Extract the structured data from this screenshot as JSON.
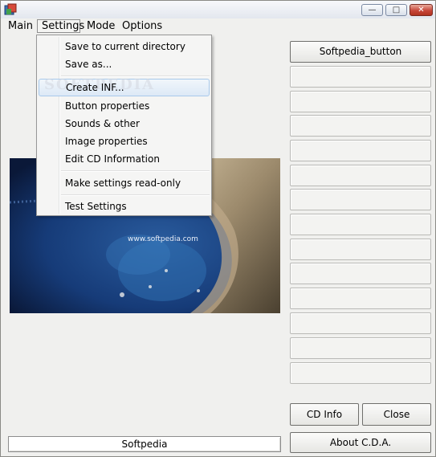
{
  "menubar": {
    "items": [
      "Main",
      "Settings",
      "Mode",
      "Options"
    ],
    "open": "Settings"
  },
  "settings_menu": {
    "items": [
      "Save to current directory",
      "Save as...",
      "Create INF...",
      "Button properties",
      "Sounds & other",
      "Image properties",
      "Edit CD Information",
      "Make settings read-only",
      "Test Settings"
    ],
    "highlighted": "Create INF...",
    "watermark": "SOFTPEDIA"
  },
  "image_panel": {
    "caption": "www.softpedia.com"
  },
  "status_field": {
    "value": "Softpedia"
  },
  "right_panel": {
    "top_button": "Softpedia_button",
    "empty_button_count": 14,
    "cd_info": "CD Info",
    "close": "Close",
    "about": "About C.D.A."
  },
  "colors": {
    "menu_highlight": "#dde9f6",
    "menu_highlight_border": "#a8c9eb",
    "window_bg": "#f0f0ee",
    "close_button": "#c7473a"
  },
  "icons": {
    "app": "app-icon",
    "minimize": "minimize-icon",
    "maximize": "maximize-icon",
    "close": "close-icon"
  }
}
